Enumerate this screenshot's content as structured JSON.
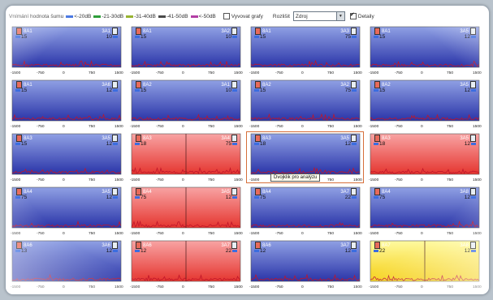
{
  "toolbar": {
    "title": "Vnímání hodnota šumu",
    "legend": [
      {
        "label": "<-20dB",
        "color": "#3b6de0"
      },
      {
        "label": "-21-30dB",
        "color": "#2e9e3a"
      },
      {
        "label": "-31-40dB",
        "color": "#97b331"
      },
      {
        "label": "-41-50dB",
        "color": "#4a4a4a"
      },
      {
        "label": "<-50dB",
        "color": "#b23fa4"
      }
    ],
    "show_graphs_label": "Vyvovat grafy",
    "show_graphs_checked": false,
    "sort_label": "Rozlišit",
    "sort_value": "Zdroj",
    "detail_label": "Detaily",
    "detail_checked": true
  },
  "tooltip": "Dvojklik pro analýzu",
  "axis_ticks": [
    "-1500",
    "-750",
    "0",
    "750",
    "1500"
  ],
  "colors": {
    "blue_top": "#8fa0e4",
    "blue_bottom": "#2a34a8",
    "red_top": "#f8a3a3",
    "red_bottom": "#e5352f",
    "yellow_top": "#fffaa0",
    "yellow_bottom": "#f5cf12",
    "noise": "#c0162a"
  },
  "panels": [
    {
      "left_id": "8A1",
      "right_id": "3A1",
      "left_value": "15",
      "right_value": "10",
      "fill": "blue",
      "divider": false,
      "selected": false
    },
    {
      "left_id": "8A1",
      "right_id": "3A2",
      "left_value": "15",
      "right_value": "10",
      "fill": "blue",
      "divider": false,
      "selected": false
    },
    {
      "left_id": "8A1",
      "right_id": "3A3",
      "left_value": "15",
      "right_value": "75",
      "fill": "blue",
      "divider": false,
      "selected": false
    },
    {
      "left_id": "8A1",
      "right_id": "3A5",
      "left_value": "15",
      "right_value": "12",
      "fill": "blue",
      "divider": false,
      "selected": false
    },
    {
      "left_id": "8A1",
      "right_id": "3A6",
      "left_value": "15",
      "right_value": "12",
      "fill": "blue",
      "divider": false,
      "selected": false
    },
    {
      "left_id": "8A2",
      "right_id": "3A1",
      "left_value": "15",
      "right_value": "10",
      "fill": "blue",
      "divider": false,
      "selected": false
    },
    {
      "left_id": "8A2",
      "right_id": "3A2",
      "left_value": "15",
      "right_value": "75",
      "fill": "blue",
      "divider": false,
      "selected": false
    },
    {
      "left_id": "8A2",
      "right_id": "3A5",
      "left_value": "15",
      "right_value": "12",
      "fill": "blue",
      "divider": false,
      "selected": false
    },
    {
      "left_id": "8A3",
      "right_id": "3A5",
      "left_value": "15",
      "right_value": "12",
      "fill": "blue",
      "divider": false,
      "selected": false
    },
    {
      "left_id": "8A3",
      "right_id": "3A4",
      "left_value": "18",
      "right_value": "75",
      "fill": "red",
      "divider": true,
      "selected": false
    },
    {
      "left_id": "8A3",
      "right_id": "3A5",
      "left_value": "18",
      "right_value": "12",
      "fill": "blue",
      "divider": false,
      "selected": true
    },
    {
      "left_id": "8A3",
      "right_id": "3A5",
      "left_value": "18",
      "right_value": "12",
      "fill": "red",
      "divider": false,
      "selected": false
    },
    {
      "left_id": "8A4",
      "right_id": "3A5",
      "left_value": "75",
      "right_value": "12",
      "fill": "blue",
      "divider": false,
      "selected": false
    },
    {
      "left_id": "8A4",
      "right_id": "3A5",
      "left_value": "75",
      "right_value": "12",
      "fill": "red",
      "divider": true,
      "selected": false
    },
    {
      "left_id": "8A4",
      "right_id": "3A7",
      "left_value": "75",
      "right_value": "22",
      "fill": "blue",
      "divider": false,
      "selected": false
    },
    {
      "left_id": "8A4",
      "right_id": "3A8",
      "left_value": "75",
      "right_value": "12",
      "fill": "blue",
      "divider": false,
      "selected": false
    },
    {
      "left_id": "8A6",
      "right_id": "3A6",
      "left_value": "13",
      "right_value": "12",
      "fill": "blue",
      "divider": false,
      "selected": false
    },
    {
      "left_id": "8A6",
      "right_id": "3A7",
      "left_value": "12",
      "right_value": "22",
      "fill": "red",
      "divider": true,
      "selected": false
    },
    {
      "left_id": "8A6",
      "right_id": "3A7",
      "left_value": "12",
      "right_value": "12",
      "fill": "blue",
      "divider": false,
      "selected": false
    },
    {
      "left_id": "8A7",
      "right_id": "3A8",
      "left_value": "22",
      "right_value": "12",
      "fill": "yellow",
      "divider": true,
      "selected": false
    }
  ]
}
